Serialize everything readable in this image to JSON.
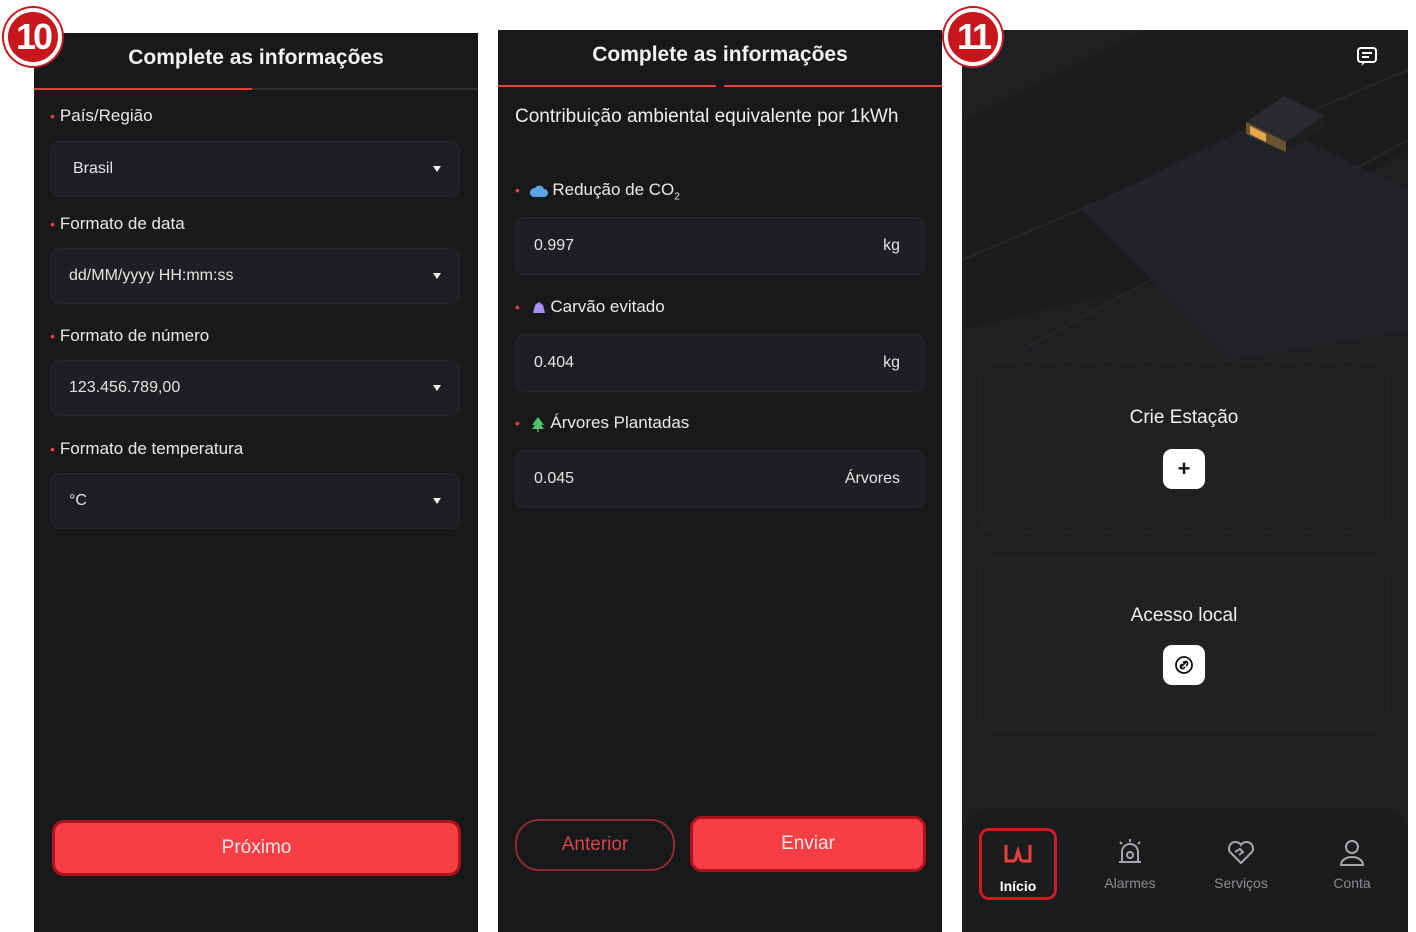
{
  "badges": {
    "step_a": "10",
    "step_b": "11"
  },
  "screen1": {
    "title": "Complete as informações",
    "fields": [
      {
        "label": "País/Região",
        "value": "Brasil"
      },
      {
        "label": "Formato de data",
        "value": "dd/MM/yyyy HH:mm:ss"
      },
      {
        "label": "Formato de número",
        "value": "123.456.789,00"
      },
      {
        "label": "Formato de temperatura",
        "value": "°C"
      }
    ],
    "next_button": "Próximo"
  },
  "screen2": {
    "title": "Complete as informações",
    "section_heading": "Contribuição ambiental equivalente por 1kWh",
    "fields": [
      {
        "label": "Redução de CO",
        "label_sub": "2",
        "value": "0.997",
        "unit": "kg",
        "icon": "cloud-icon"
      },
      {
        "label": "Carvão evitado",
        "value": "0.404",
        "unit": "kg",
        "icon": "coal-icon"
      },
      {
        "label": "Árvores Plantadas",
        "value": "0.045",
        "unit": "Árvores",
        "icon": "tree-icon"
      }
    ],
    "back_button": "Anterior",
    "submit_button": "Enviar"
  },
  "screen3": {
    "create_station": "Crie Estação",
    "local_access": "Acesso local",
    "tabs": [
      {
        "label": "Início",
        "icon": "home-logo-icon",
        "active": true
      },
      {
        "label": "Alarmes",
        "icon": "alarm-icon",
        "active": false
      },
      {
        "label": "Serviços",
        "icon": "services-heart-icon",
        "active": false
      },
      {
        "label": "Conta",
        "icon": "account-icon",
        "active": false
      }
    ]
  },
  "colors": {
    "accent": "#f63f44",
    "background": "#18191b",
    "badge": "#c8161d"
  }
}
